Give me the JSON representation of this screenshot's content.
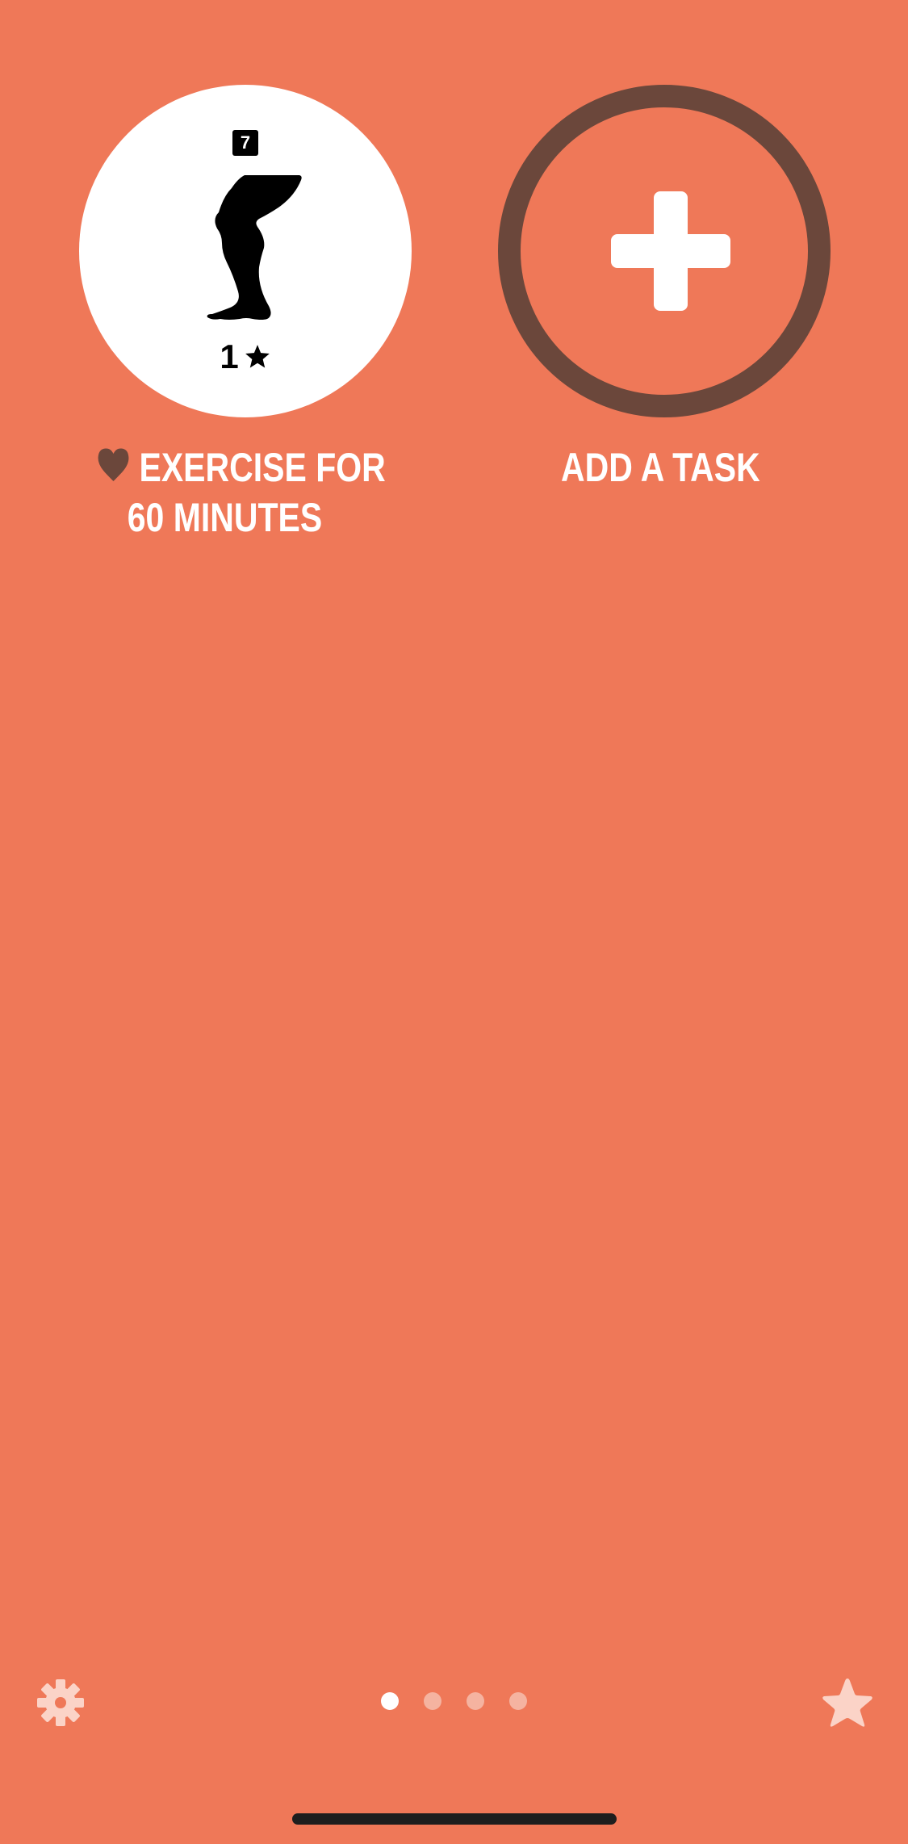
{
  "colors": {
    "background": "#EF7858",
    "task_circle_fill": "#FFFFFF",
    "add_circle_ring": "#6B473B",
    "heart": "#6B473B",
    "label_text": "#FFFFFF",
    "inactive_dot": "#F5B3A0",
    "bottom_icons": "#FBD3C7"
  },
  "tasks": [
    {
      "icon": "leg-icon",
      "day_badge": "7",
      "rating_count": "1",
      "rating_icon": "star-icon",
      "category_icon": "heart-icon",
      "label_line1": "EXERCISE FOR",
      "label_line2": "60 MINUTES"
    }
  ],
  "add_task": {
    "icon": "plus-icon",
    "label": "ADD A TASK"
  },
  "bottom_bar": {
    "left_icon": "gear-icon",
    "right_icon": "star-icon",
    "page_count": 4,
    "active_page": 1
  }
}
